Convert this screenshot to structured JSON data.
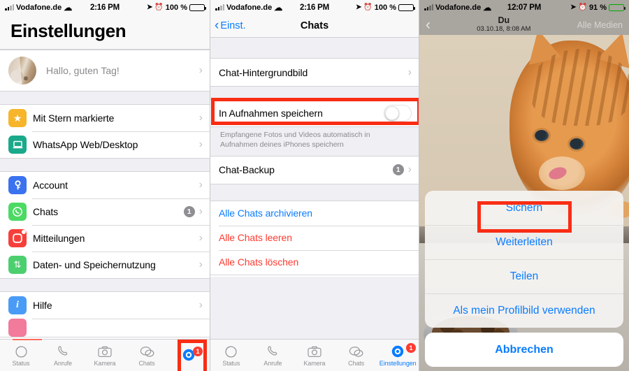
{
  "colors": {
    "accent_blue": "#0a7cff",
    "danger_red": "#ff3b30",
    "highlight_red": "#f92d14",
    "grey_badge": "#8e8e93"
  },
  "panel1": {
    "status_bar": {
      "carrier": "Vodafone.de",
      "time": "2:16 PM",
      "battery_pct": "100 %"
    },
    "title": "Einstellungen",
    "profile": {
      "greeting": "Hallo, guten Tag!"
    },
    "groups": [
      {
        "rows": [
          {
            "label": "Mit Stern markierte",
            "icon": "star-icon",
            "icon_color": "#f6b52b",
            "glyph": "★"
          },
          {
            "label": "WhatsApp Web/Desktop",
            "icon": "laptop-icon",
            "icon_color": "#1aa98a",
            "glyph": "ὋB"
          }
        ]
      },
      {
        "rows": [
          {
            "label": "Account",
            "icon": "key-icon",
            "icon_color": "#3a72f0",
            "glyph": "⚷"
          },
          {
            "label": "Chats",
            "icon": "whatsapp-icon",
            "icon_color": "#4cd964",
            "glyph": "✆",
            "badge": "1"
          },
          {
            "label": "Mitteilungen",
            "icon": "notification-icon",
            "icon_color": "#f63f3a",
            "glyph": ""
          },
          {
            "label": "Daten- und Speichernutzung",
            "icon": "data-usage-icon",
            "icon_color": "#4ccf6e",
            "glyph": "⇅"
          }
        ]
      },
      {
        "rows": [
          {
            "label": "Hilfe",
            "icon": "info-icon",
            "icon_color": "#4a9bf5",
            "glyph": "i"
          }
        ]
      }
    ],
    "tabbar": {
      "tabs": [
        {
          "label": "Status",
          "icon": "status-ring-icon",
          "active": false
        },
        {
          "label": "Anrufe",
          "icon": "phone-icon",
          "active": false
        },
        {
          "label": "Kamera",
          "icon": "camera-icon",
          "active": false
        },
        {
          "label": "Chats",
          "icon": "chat-bubbles-icon",
          "active": false
        },
        {
          "label": "",
          "icon": "gear-icon",
          "active": true,
          "badge": "1"
        }
      ]
    }
  },
  "panel2": {
    "status_bar": {
      "carrier": "Vodafone.de",
      "time": "2:16 PM",
      "battery_pct": "100 %"
    },
    "nav": {
      "back_label": "Einst.",
      "title": "Chats"
    },
    "rows_top": [
      {
        "label": "Chat-Hintergrundbild"
      }
    ],
    "toggle_row": {
      "label": "In Aufnahmen speichern",
      "state": "off"
    },
    "toggle_footnote": "Empfangene Fotos und Videos automatisch in Aufnahmen deines iPhones speichern",
    "backup_row": {
      "label": "Chat-Backup",
      "badge": "1"
    },
    "action_rows": [
      {
        "label": "Alle Chats archivieren",
        "style": "blue"
      },
      {
        "label": "Alle Chats leeren",
        "style": "red"
      },
      {
        "label": "Alle Chats löschen",
        "style": "red"
      }
    ],
    "tabbar": {
      "tabs": [
        {
          "label": "Status",
          "icon": "status-ring-icon",
          "active": false
        },
        {
          "label": "Anrufe",
          "icon": "phone-icon",
          "active": false
        },
        {
          "label": "Kamera",
          "icon": "camera-icon",
          "active": false
        },
        {
          "label": "Chats",
          "icon": "chat-bubbles-icon",
          "active": false
        },
        {
          "label": "Einstellungen",
          "icon": "gear-icon",
          "active": true,
          "badge": "1"
        }
      ]
    }
  },
  "panel3": {
    "status_bar": {
      "carrier": "Vodafone.de",
      "time": "12:07 PM",
      "battery_pct": "91 %",
      "charging": true
    },
    "header": {
      "title": "Du",
      "subtitle": "03.10.18, 8:08 AM",
      "right_label": "Alle Medien"
    },
    "photo_alt": "orange tabby cat eating from a metal bowl",
    "action_sheet": {
      "items": [
        {
          "label": "Sichern",
          "highlighted": true
        },
        {
          "label": "Weiterleiten",
          "highlighted": false
        },
        {
          "label": "Teilen",
          "highlighted": false
        },
        {
          "label": "Als mein Profilbild verwenden",
          "highlighted": false
        }
      ],
      "cancel_label": "Abbrechen"
    }
  }
}
